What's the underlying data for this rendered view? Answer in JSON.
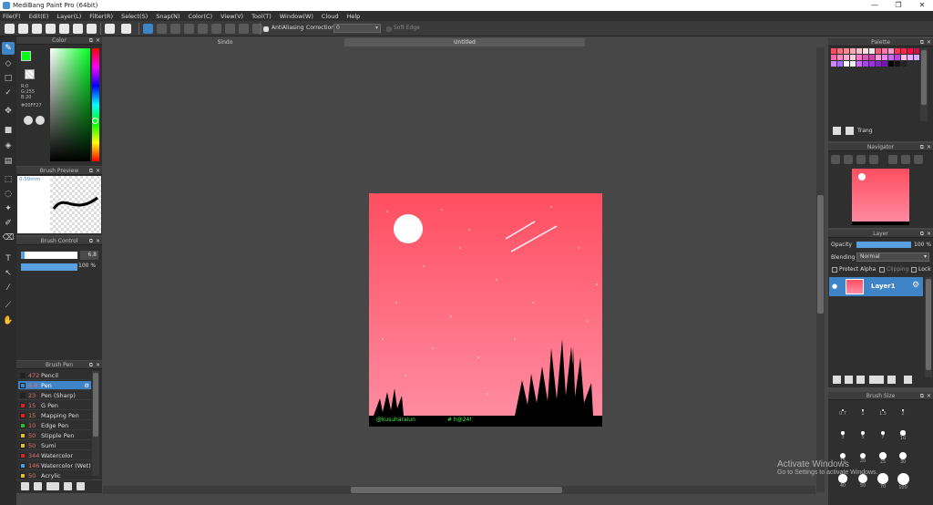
{
  "window": {
    "title": "MediBang Paint Pro (64bit)",
    "minimize": "—",
    "restore": "❐",
    "close": "✕"
  },
  "menu": [
    "File(F)",
    "Edit(E)",
    "Layer(L)",
    "Filter(R)",
    "Select(S)",
    "Snap(N)",
    "Color(C)",
    "View(V)",
    "Tool(T)",
    "Window(W)",
    "Cloud",
    "Help"
  ],
  "toolbar": {
    "antialiasing_label": "AntiAliasing",
    "correction_label": "Correction",
    "correction_value": "0",
    "soft_edge_label": "Soft Edge"
  },
  "color_panel": {
    "title": "Color",
    "r": "R:0",
    "g": "G:255",
    "b": "B:20",
    "hex": "#00FF27",
    "fg_color": "#00ff14",
    "bg_color": "#ffffff"
  },
  "brush_preview": {
    "title": "Brush Preview",
    "size": "0.50mm"
  },
  "brush_control": {
    "title": "Brush Control",
    "size_value": "6.8",
    "opacity_value": "100 %"
  },
  "brush_pen": {
    "title": "Brush Pen",
    "items": [
      {
        "size": "472",
        "name": "Pencil",
        "color": "#222222"
      },
      {
        "size": "6.8",
        "name": "Pen",
        "color": "#3e84c6"
      },
      {
        "size": "23",
        "name": "Pen (Sharp)",
        "color": "#222222"
      },
      {
        "size": "15",
        "name": "G Pen",
        "color": "#e02020"
      },
      {
        "size": "15",
        "name": "Mapping Pen",
        "color": "#e02020"
      },
      {
        "size": "10",
        "name": "Edge Pen",
        "color": "#20c020"
      },
      {
        "size": "50",
        "name": "Stipple Pen",
        "color": "#e0c020"
      },
      {
        "size": "50",
        "name": "Sumi",
        "color": "#e0c020"
      },
      {
        "size": "344",
        "name": "Watercolor",
        "color": "#e02020"
      },
      {
        "size": "146",
        "name": "Watercolor (Wet)",
        "color": "#40a0e0"
      },
      {
        "size": "50",
        "name": "Acrylic",
        "color": "#e0c020"
      }
    ]
  },
  "canvas": {
    "tab_1": "Sindo",
    "tab_2": "Untitled",
    "credit": "@kusuharaiun",
    "hashtag": "# h@24!"
  },
  "palette": {
    "title": "Palette",
    "name": "Trang",
    "colors": [
      "#ff4d5e",
      "#ff6b7a",
      "#ff8896",
      "#ffa6b0",
      "#ffc2ca",
      "#ffdde2",
      "#e8e8e8",
      "#ff5577",
      "#ff77aa",
      "#ff99cc",
      "#ff3355",
      "#ff2244",
      "#ee1144",
      "#cc1144",
      "#ff66aa",
      "#ff88bb",
      "#ffaacc",
      "#ffccdd",
      "#ff77cc",
      "#dd55bb",
      "#cc44aa",
      "#ff99dd",
      "#ee88ee",
      "#cc66ee",
      "#bb44dd",
      "#ffbbee",
      "#eeaaff",
      "#ddaaff",
      "#cc88ff",
      "#aa66ff",
      "#ffffff",
      "#eeeeee",
      "#cc66ff",
      "#aa44ee",
      "#9933dd",
      "#8822cc",
      "#7711bb",
      "#000000",
      "#111111",
      "#222222"
    ]
  },
  "navigator": {
    "title": "Navigator"
  },
  "layer_panel": {
    "title": "Layer",
    "opacity_label": "Opacity",
    "opacity_value": "100 %",
    "blending_label": "Blending",
    "blending_value": "Normal",
    "protect_alpha": "Protect Alpha",
    "clipping": "Clipping",
    "lock": "Lock",
    "layer_name": "Layer1"
  },
  "brush_size": {
    "title": "Brush Size",
    "sizes": [
      "0.7",
      "1",
      "1.5",
      "2",
      "3",
      "5",
      "7",
      "10",
      "15",
      "20",
      "25",
      "30",
      "40",
      "50",
      "70",
      "100"
    ]
  },
  "system_watermark": {
    "line1": "Activate Windows",
    "line2": "Go to Settings to activate Windows."
  },
  "icons": [
    "brush-icon",
    "eraser-icon",
    "rectangle-icon",
    "checkmark-icon",
    "move-icon",
    "fill-icon",
    "bucket-icon",
    "gradient-icon",
    "select-icon",
    "lasso-icon",
    "magic-wand-icon",
    "select-pen-icon",
    "select-eraser-icon",
    "text-icon",
    "operation-icon",
    "eyedropper-icon",
    "divide-icon",
    "hand-icon"
  ]
}
